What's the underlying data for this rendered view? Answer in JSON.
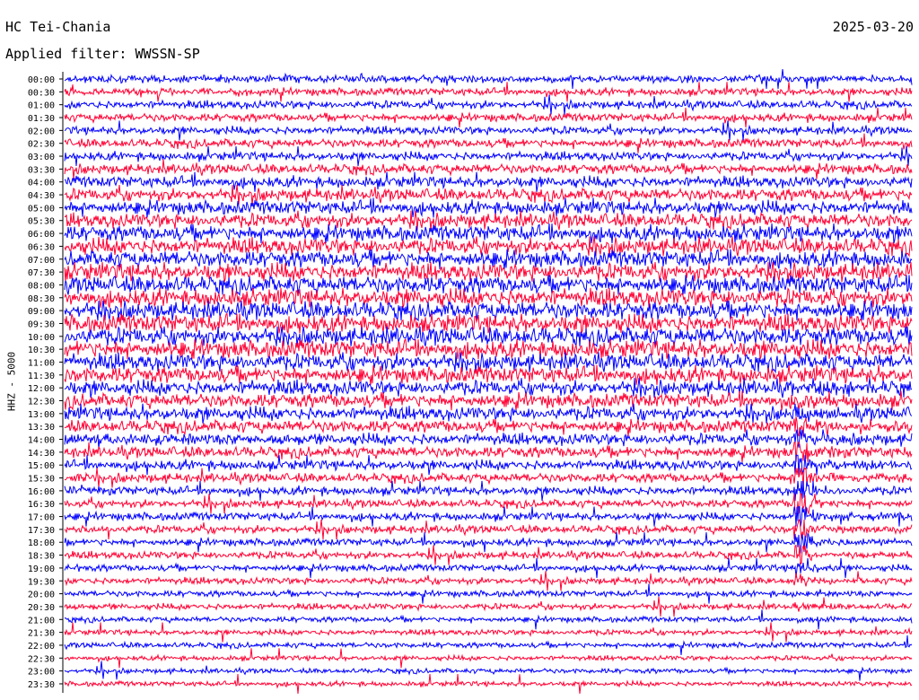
{
  "header": {
    "station": "HC Tei-Chania",
    "filter": "Applied filter: WWSSN-SP",
    "date": "2025-03-20"
  },
  "channel_label": "HHZ - 5000",
  "colors": {
    "trace_a": "#0000ff",
    "trace_b": "#ff0033",
    "axis": "#000000",
    "background": "#ffffff"
  },
  "chart_data": {
    "type": "line",
    "title": "HC Tei-Chania",
    "subtitle": "Applied filter: WWSSN-SP",
    "ylabel": "HHZ - 5000",
    "date": "2025-03-20",
    "rows": [
      "00:00",
      "00:30",
      "01:00",
      "01:30",
      "02:00",
      "02:30",
      "03:00",
      "03:30",
      "04:00",
      "04:30",
      "05:00",
      "05:30",
      "06:00",
      "06:30",
      "07:00",
      "07:30",
      "08:00",
      "08:30",
      "09:00",
      "09:30",
      "10:00",
      "10:30",
      "11:00",
      "11:30",
      "12:00",
      "12:30",
      "13:00",
      "13:30",
      "14:00",
      "14:30",
      "15:00",
      "15:30",
      "16:00",
      "16:30",
      "17:00",
      "17:30",
      "18:00",
      "18:30",
      "19:00",
      "19:30",
      "20:00",
      "20:30",
      "21:00",
      "21:30",
      "22:00",
      "22:30",
      "23:00",
      "23:30"
    ],
    "row_minutes": 30,
    "trace_colors": [
      "#0000ff",
      "#ff0033"
    ],
    "noise_level": [
      1.2,
      1.2,
      1.3,
      1.3,
      1.3,
      1.4,
      1.4,
      1.6,
      1.8,
      2.0,
      2.2,
      2.3,
      2.5,
      2.6,
      2.7,
      2.8,
      2.8,
      2.9,
      2.9,
      2.9,
      2.9,
      2.9,
      2.7,
      2.6,
      2.4,
      2.3,
      2.2,
      2.0,
      1.9,
      1.8,
      1.6,
      1.5,
      1.4,
      1.3,
      1.3,
      1.3,
      1.2,
      1.2,
      1.1,
      1.1,
      1.0,
      1.0,
      0.9,
      0.9,
      0.9,
      0.8,
      0.8,
      0.8
    ],
    "event": {
      "start_row": "12:00",
      "onset_minute": 26,
      "peak_row": "17:00",
      "end_row": "21:00"
    }
  }
}
